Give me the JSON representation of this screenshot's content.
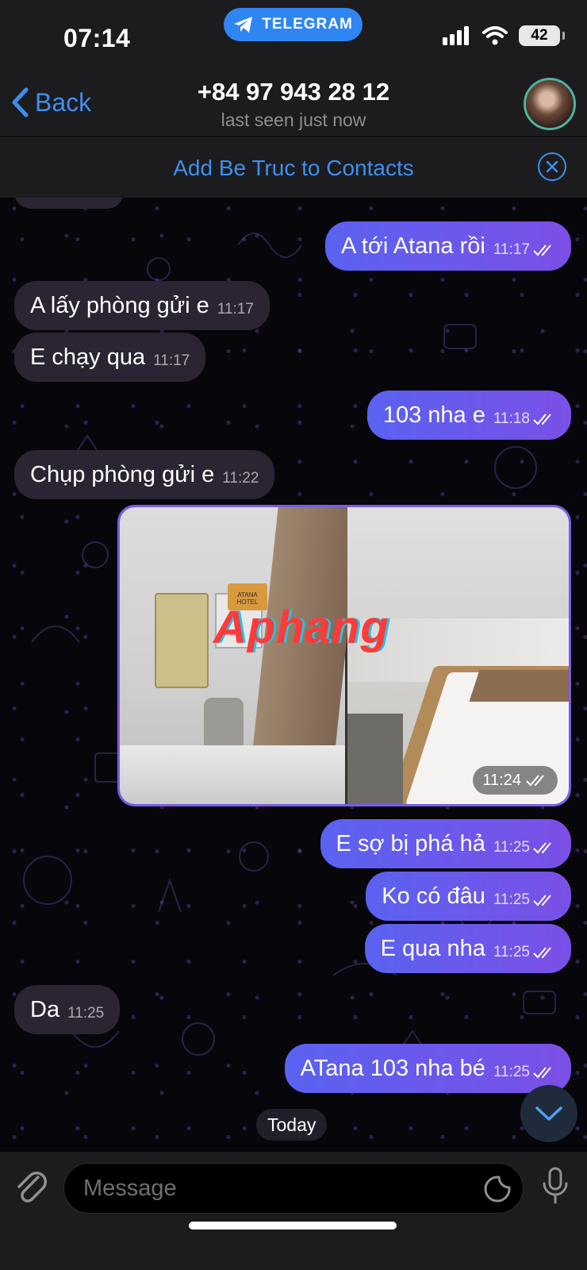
{
  "status": {
    "time": "07:14",
    "battery": "42",
    "app_pill": "TELEGRAM"
  },
  "header": {
    "back_label": "Back",
    "title": "+84 97 943 28 12",
    "subtitle": "last seen just now"
  },
  "contact_bar": {
    "label": "Add Be Truc to Contacts"
  },
  "messages": [
    {
      "text": "A tới Atana rồi",
      "time": "11:17"
    },
    {
      "text": "A lấy phòng gửi e",
      "time": "11:17"
    },
    {
      "text": "E chạy qua",
      "time": "11:17"
    },
    {
      "text": "103 nha e",
      "time": "11:18"
    },
    {
      "text": "Chụp phòng gửi e",
      "time": "11:22"
    },
    {
      "text": "E sợ bị phá hả",
      "time": "11:25"
    },
    {
      "text": "Ko có đâu",
      "time": "11:25"
    },
    {
      "text": "E qua nha",
      "time": "11:25"
    },
    {
      "text": "Da",
      "time": "11:25"
    },
    {
      "text": "ATana 103 nha bé",
      "time": "11:25"
    }
  ],
  "photo": {
    "time": "11:24",
    "watermark": "Aphang",
    "sign_text": "ATANA HOTEL"
  },
  "date_chip": "Today",
  "composer": {
    "placeholder": "Message"
  },
  "icons": [
    "telegram-icon",
    "signal-icon",
    "wifi-icon",
    "back-chevron-icon",
    "close-circle-icon",
    "double-check-icon",
    "chevron-down-icon",
    "paperclip-icon",
    "sticker-icon",
    "microphone-icon"
  ],
  "colors": {
    "accent": "#3e8ef0",
    "outgoing_bubble": "#6a55e8",
    "incoming_bubble": "#2b2533",
    "background": "#07060b"
  }
}
